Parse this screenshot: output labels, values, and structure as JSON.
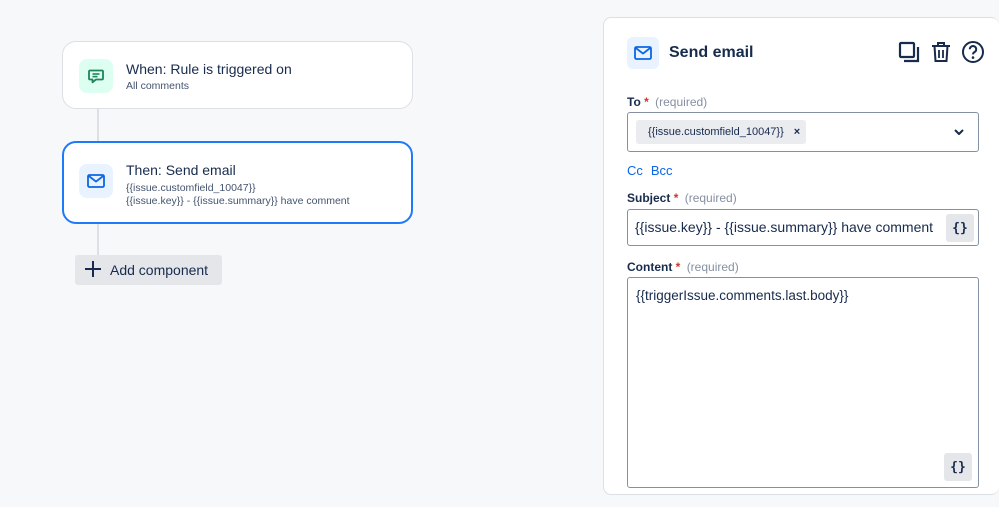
{
  "rule_flow": {
    "trigger": {
      "title": "When: Rule is triggered on",
      "subtitle": "All comments",
      "icon": "comment-icon"
    },
    "action": {
      "title": "Then: Send email",
      "line1": "{{issue.customfield_10047}}",
      "line2": "{{issue.key}} - {{issue.summary}} have comment",
      "icon": "mail-icon"
    },
    "add_component_label": "Add component"
  },
  "panel": {
    "title": "Send email",
    "to": {
      "label": "To",
      "required_marker": "*",
      "required_hint": "(required)",
      "tags": [
        "{{issue.customfield_10047}}"
      ]
    },
    "cc_label": "Cc",
    "bcc_label": "Bcc",
    "subject": {
      "label": "Subject",
      "required_marker": "*",
      "required_hint": "(required)",
      "value": "{{issue.key}} - {{issue.summary}} have comment"
    },
    "content": {
      "label": "Content",
      "required_marker": "*",
      "required_hint": "(required)",
      "value": "{{triggerIssue.comments.last.body}}"
    },
    "smart_value_button": "{}"
  },
  "colors": {
    "accent": "#1d7afc",
    "link": "#0c66e4",
    "required": "#c9372c",
    "trigger_icon_bg": "#dcfff1",
    "action_icon_bg": "#e9f2ff"
  }
}
